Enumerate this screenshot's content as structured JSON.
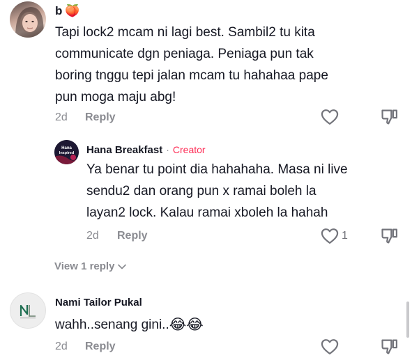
{
  "comments": [
    {
      "username": "b",
      "username_emoji": "🍑",
      "text_lines": [
        "Tapi lock2 mcam ni lagi best. Sambil2 tu kita",
        "communicate dgn peniaga. Peniaga pun tak",
        "boring tnggu tepi jalan mcam tu hahahaa pape",
        "pun moga maju abg!"
      ],
      "time": "2d",
      "reply_label": "Reply"
    },
    {
      "username": "Hana Breakfast",
      "separator": "·",
      "badge": "Creator",
      "avatar_text_1": "Hana",
      "avatar_text_2": "Inspired",
      "text_lines": [
        "Ya benar tu point dia hahahaha. Masa ni live",
        "sendu2 dan orang pun x ramai boleh la",
        "layan2 lock. Kalau ramai xboleh la hahah"
      ],
      "time": "2d",
      "reply_label": "Reply",
      "like_count": "1"
    },
    {
      "username": "Nami Tailor Pukal",
      "text": "wahh..senang gini..",
      "emojis": "😂😂",
      "time": "2d",
      "reply_label": "Reply"
    }
  ],
  "view_replies_label": "View 1 reply",
  "colors": {
    "text": "#161823",
    "muted": "#8a8b91",
    "creator": "#fe2c55"
  }
}
